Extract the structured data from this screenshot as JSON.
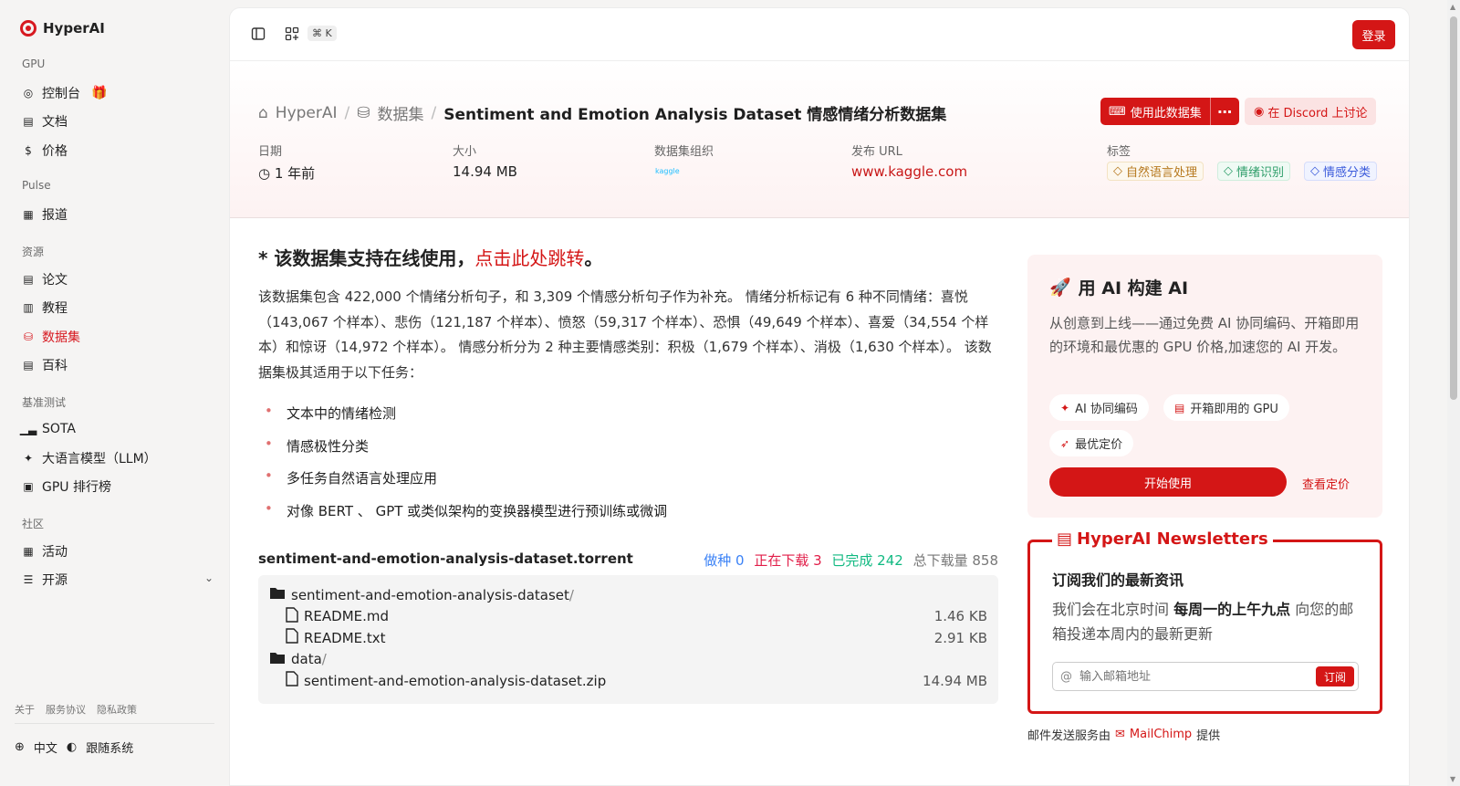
{
  "app": {
    "name": "HyperAI"
  },
  "sidebar": {
    "sections": [
      {
        "title": "GPU",
        "items": [
          {
            "label": "控制台",
            "icon": "gauge-icon"
          },
          {
            "label": "文档",
            "icon": "doc-icon"
          },
          {
            "label": "价格",
            "icon": "price-icon"
          }
        ]
      },
      {
        "title": "Pulse",
        "items": [
          {
            "label": "报道",
            "icon": "news-icon"
          }
        ]
      },
      {
        "title": "资源",
        "items": [
          {
            "label": "论文",
            "icon": "paper-icon"
          },
          {
            "label": "教程",
            "icon": "book-icon"
          },
          {
            "label": "数据集",
            "icon": "database-icon",
            "active": true
          },
          {
            "label": "百科",
            "icon": "wiki-icon"
          }
        ]
      },
      {
        "title": "基准测试",
        "items": [
          {
            "label": "SOTA",
            "icon": "chart-icon"
          },
          {
            "label": "大语言模型（LLM）",
            "icon": "sparkle-icon"
          },
          {
            "label": "GPU 排行榜",
            "icon": "chip-icon"
          }
        ]
      },
      {
        "title": "社区",
        "items": [
          {
            "label": "活动",
            "icon": "calendar-icon"
          },
          {
            "label": "开源",
            "icon": "list-icon"
          }
        ]
      }
    ],
    "footer_links": [
      "关于",
      "服务协议",
      "隐私政策"
    ],
    "language": "中文",
    "theme": "跟随系统"
  },
  "topbar": {
    "shortcut": "⌘ K",
    "login": "登录"
  },
  "header": {
    "breadcrumb": {
      "home": "HyperAI",
      "section": "数据集",
      "current": "Sentiment and Emotion Analysis Dataset 情感情绪分析数据集"
    },
    "use_button": "使用此数据集",
    "discord_button": "在 Discord 上讨论",
    "meta": {
      "date_label": "日期",
      "date_value": "1 年前",
      "size_label": "大小",
      "size_value": "14.94 MB",
      "org_label": "数据集组织",
      "org_value": "kaggle",
      "url_label": "发布 URL",
      "url_value": "www.kaggle.com",
      "tags_label": "标签"
    },
    "tags": [
      {
        "label": "自然语言处理",
        "color": "#b7791f"
      },
      {
        "label": "情绪识别",
        "color": "#2f9e6a"
      },
      {
        "label": "情感分类",
        "color": "#3b5bdb"
      }
    ]
  },
  "content": {
    "notice_prefix": "* 该数据集支持在线使用，",
    "notice_link": "点击此处跳转",
    "notice_suffix": "。",
    "description": "该数据集包含 422,000 个情绪分析句子，和 3,309 个情感分析句子作为补充。 情绪分析标记有 6 种不同情绪：喜悦（143,067 个样本）、悲伤（121,187 个样本）、愤怒（59,317 个样本）、恐惧（49,649 个样本）、喜爱（34,554 个样本）和惊讶（14,972 个样本）。 情感分析分为 2 种主要情感类别：积极（1,679 个样本）、消极（1,630 个样本）。 该数据集极其适用于以下任务：",
    "tasks": [
      "文本中的情绪检测",
      "情感极性分类",
      "多任务自然语言处理应用",
      "对像 BERT 、 GPT 或类似架构的变换器模型进行预训练或微调"
    ],
    "torrent": {
      "name": "sentiment-and-emotion-analysis-dataset.torrent",
      "seeding": "做种 0",
      "downloading": "正在下载 3",
      "completed": "已完成 242",
      "total": "总下载量 858"
    },
    "files": [
      {
        "name": "sentiment-and-emotion-analysis-dataset",
        "type": "folder",
        "size": ""
      },
      {
        "name": "README.md",
        "type": "file",
        "size": "1.46 KB"
      },
      {
        "name": "README.txt",
        "type": "file",
        "size": "2.91 KB"
      },
      {
        "name": "data",
        "type": "folder",
        "size": ""
      },
      {
        "name": "sentiment-and-emotion-analysis-dataset.zip",
        "type": "file",
        "size": "14.94 MB"
      }
    ]
  },
  "ai_card": {
    "title": "用 AI 构建 AI",
    "description": "从创意到上线——通过免费 AI 协同编码、开箱即用的环境和最优惠的 GPU 价格,加速您的 AI 开发。",
    "chips": [
      "AI 协同编码",
      "开箱即用的 GPU",
      "最优定价"
    ],
    "start": "开始使用",
    "pricing": "查看定价"
  },
  "newsletter": {
    "title": "HyperAI Newsletters",
    "heading": "订阅我们的最新资讯",
    "text_prefix": "我们会在北京时间 ",
    "text_bold": "每周一的上午九点",
    "text_suffix": " 向您的邮箱投递本周内的最新更新",
    "placeholder": "输入邮箱地址",
    "subscribe": "订阅",
    "provider_prefix": "邮件发送服务由",
    "provider": "MailChimp",
    "provider_suffix": "提供"
  },
  "colors": {
    "brand": "#d41616"
  }
}
